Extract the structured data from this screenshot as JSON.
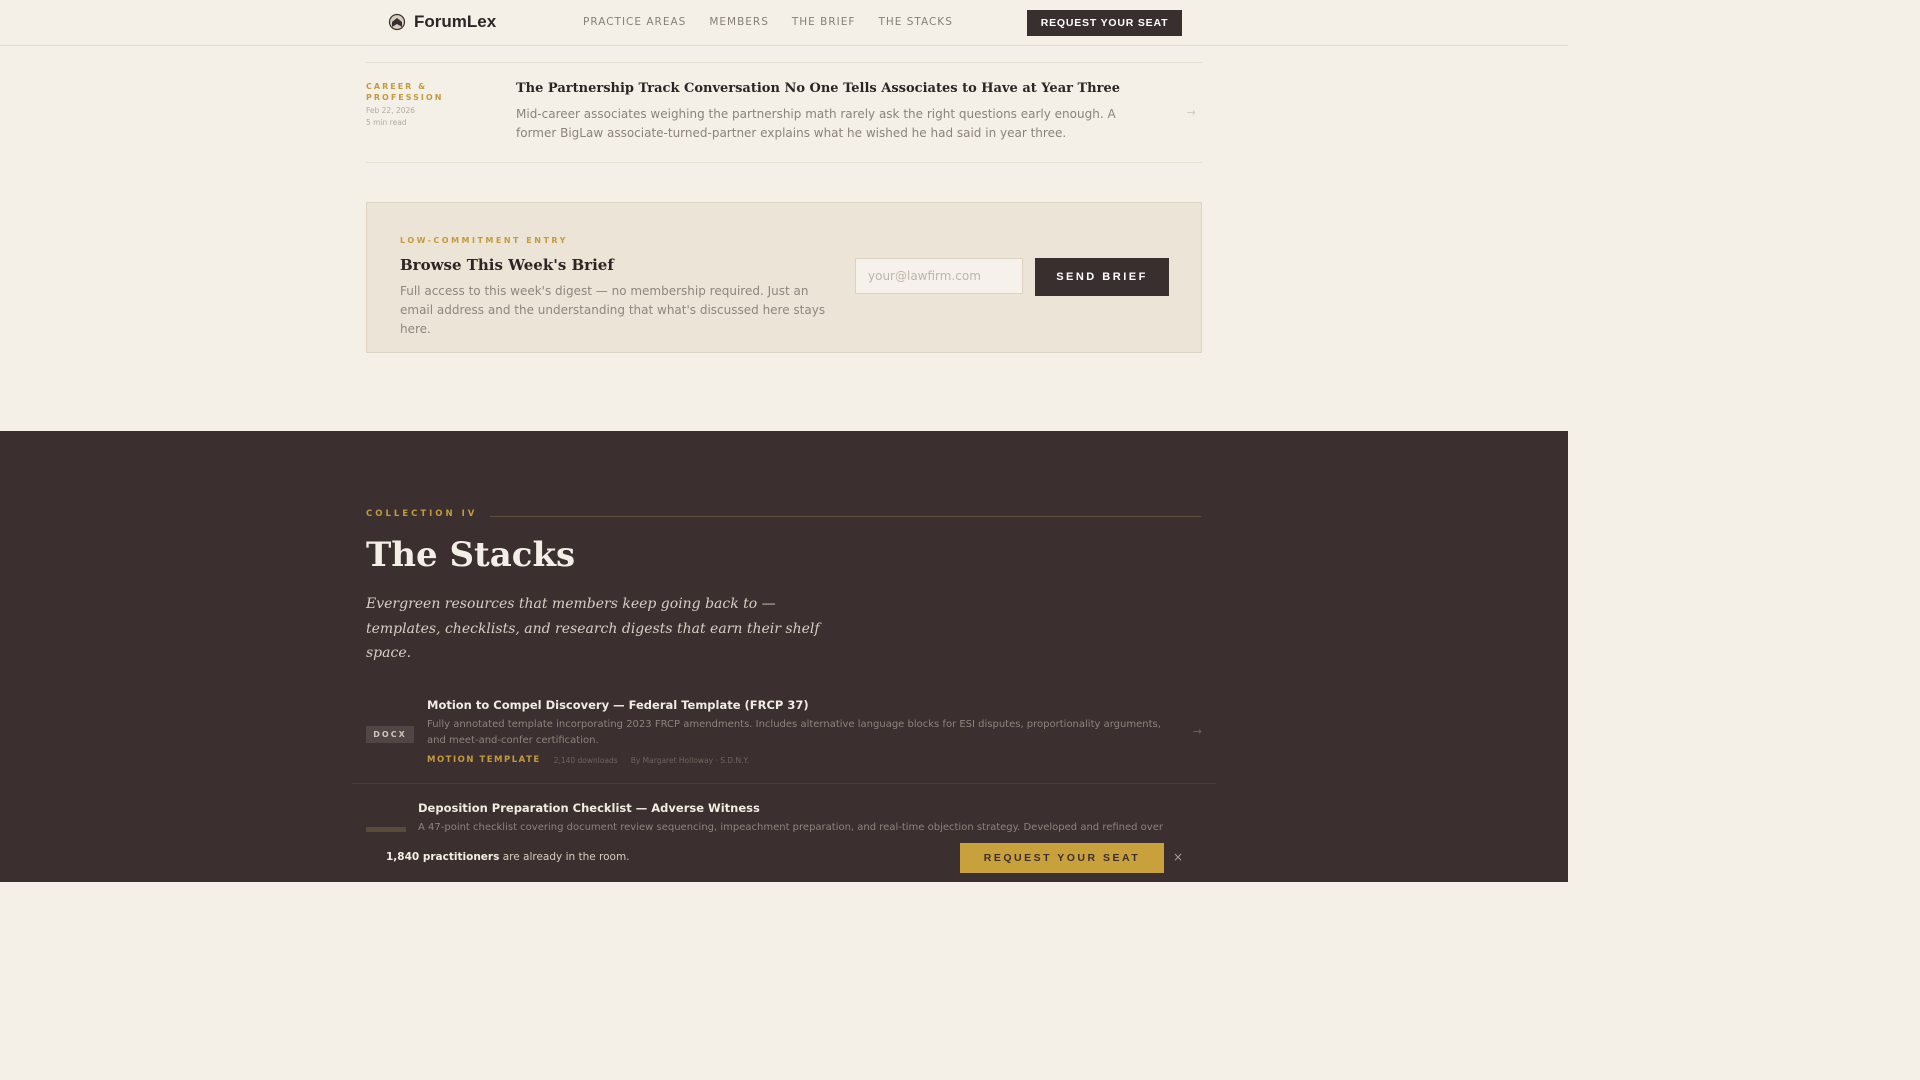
{
  "header": {
    "brand": "ForumLex",
    "nav": [
      "PRACTICE AREAS",
      "MEMBERS",
      "THE BRIEF",
      "THE STACKS"
    ],
    "cta": "REQUEST YOUR SEAT"
  },
  "article": {
    "category": "CAREER &\nPROFESSION",
    "date": "Feb 22, 2026",
    "read_time": "5 min read",
    "title": "The Partnership Track Conversation No One Tells Associates to Have at Year Three",
    "excerpt": "Mid-career associates weighing the partnership math rarely ask the right questions early enough. A former BigLaw associate-turned-partner explains what he wished he had said in year three.",
    "arrow": "→"
  },
  "brief": {
    "kicker": "LOW-COMMITMENT ENTRY",
    "title": "Browse This Week's Brief",
    "description": "Full access to this week's digest — no membership required. Just an email address and the understanding that what's discussed here stays here.",
    "email_placeholder": "your@lawfirm.com",
    "button": "SEND BRIEF"
  },
  "stacks": {
    "kicker": "COLLECTION IV",
    "title": "The Stacks",
    "subtitle": "Evergreen resources that members keep going back to — templates, checklists, and research digests that earn their shelf space.",
    "resources": [
      {
        "badge": "DOCX",
        "title": "Motion to Compel Discovery — Federal Template (FRCP 37)",
        "description": "Fully annotated template incorporating 2023 FRCP amendments. Includes alternative language blocks for ESI disputes, proportionality arguments, and meet-and-confer certification.",
        "type": "MOTION TEMPLATE",
        "downloads": "2,140 downloads",
        "author": "By Margaret Holloway · S.D.N.Y.",
        "arrow": "→"
      },
      {
        "title": "Deposition Preparation Checklist — Adverse Witness",
        "description": "A 47-point checklist covering document review sequencing, impeachment preparation, and real-time objection strategy. Developed and refined over"
      }
    ]
  },
  "sticky": {
    "count": "1,840 practitioners",
    "text": " are already in the room.",
    "button": "REQUEST YOUR SEAT",
    "close": "×"
  }
}
